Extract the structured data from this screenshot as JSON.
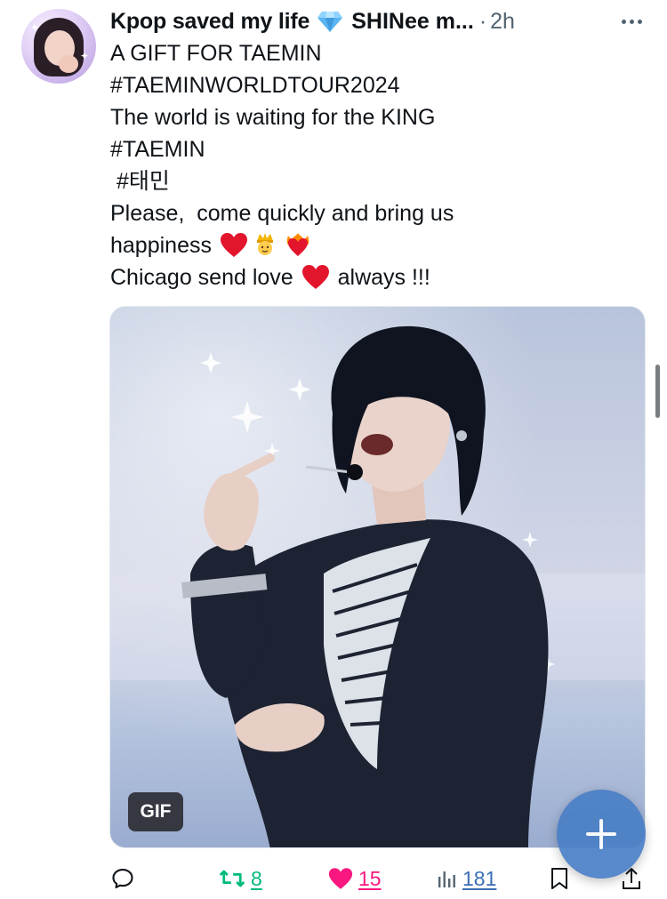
{
  "post": {
    "author_name": "Kpop saved my life",
    "handle": "SHINee m...",
    "separator": "·",
    "time": "2h",
    "lines": [
      "A GIFT FOR TAEMIN",
      "#TAEMINWORLDTOUR2024",
      "The world is waiting for the KING",
      "#TAEMIN",
      " #태민",
      "Please,  come quickly and bring us",
      "happiness",
      "Chicago send love",
      "always !!!"
    ]
  },
  "media": {
    "badge": "GIF"
  },
  "actions": {
    "retweets": "8",
    "likes": "15",
    "views": "181"
  },
  "colors": {
    "retweet_active": "#00ba7c",
    "like_active": "#f91880",
    "fab": "#4a7fc6",
    "secondary_text": "#536471"
  },
  "icons": {
    "verified_emoji": "gem-icon",
    "emojis_line_happiness": [
      "red-heart-icon",
      "crowned-person-icon",
      "heart-on-fire-icon"
    ],
    "emoji_line_chicago": "red-heart-icon"
  }
}
